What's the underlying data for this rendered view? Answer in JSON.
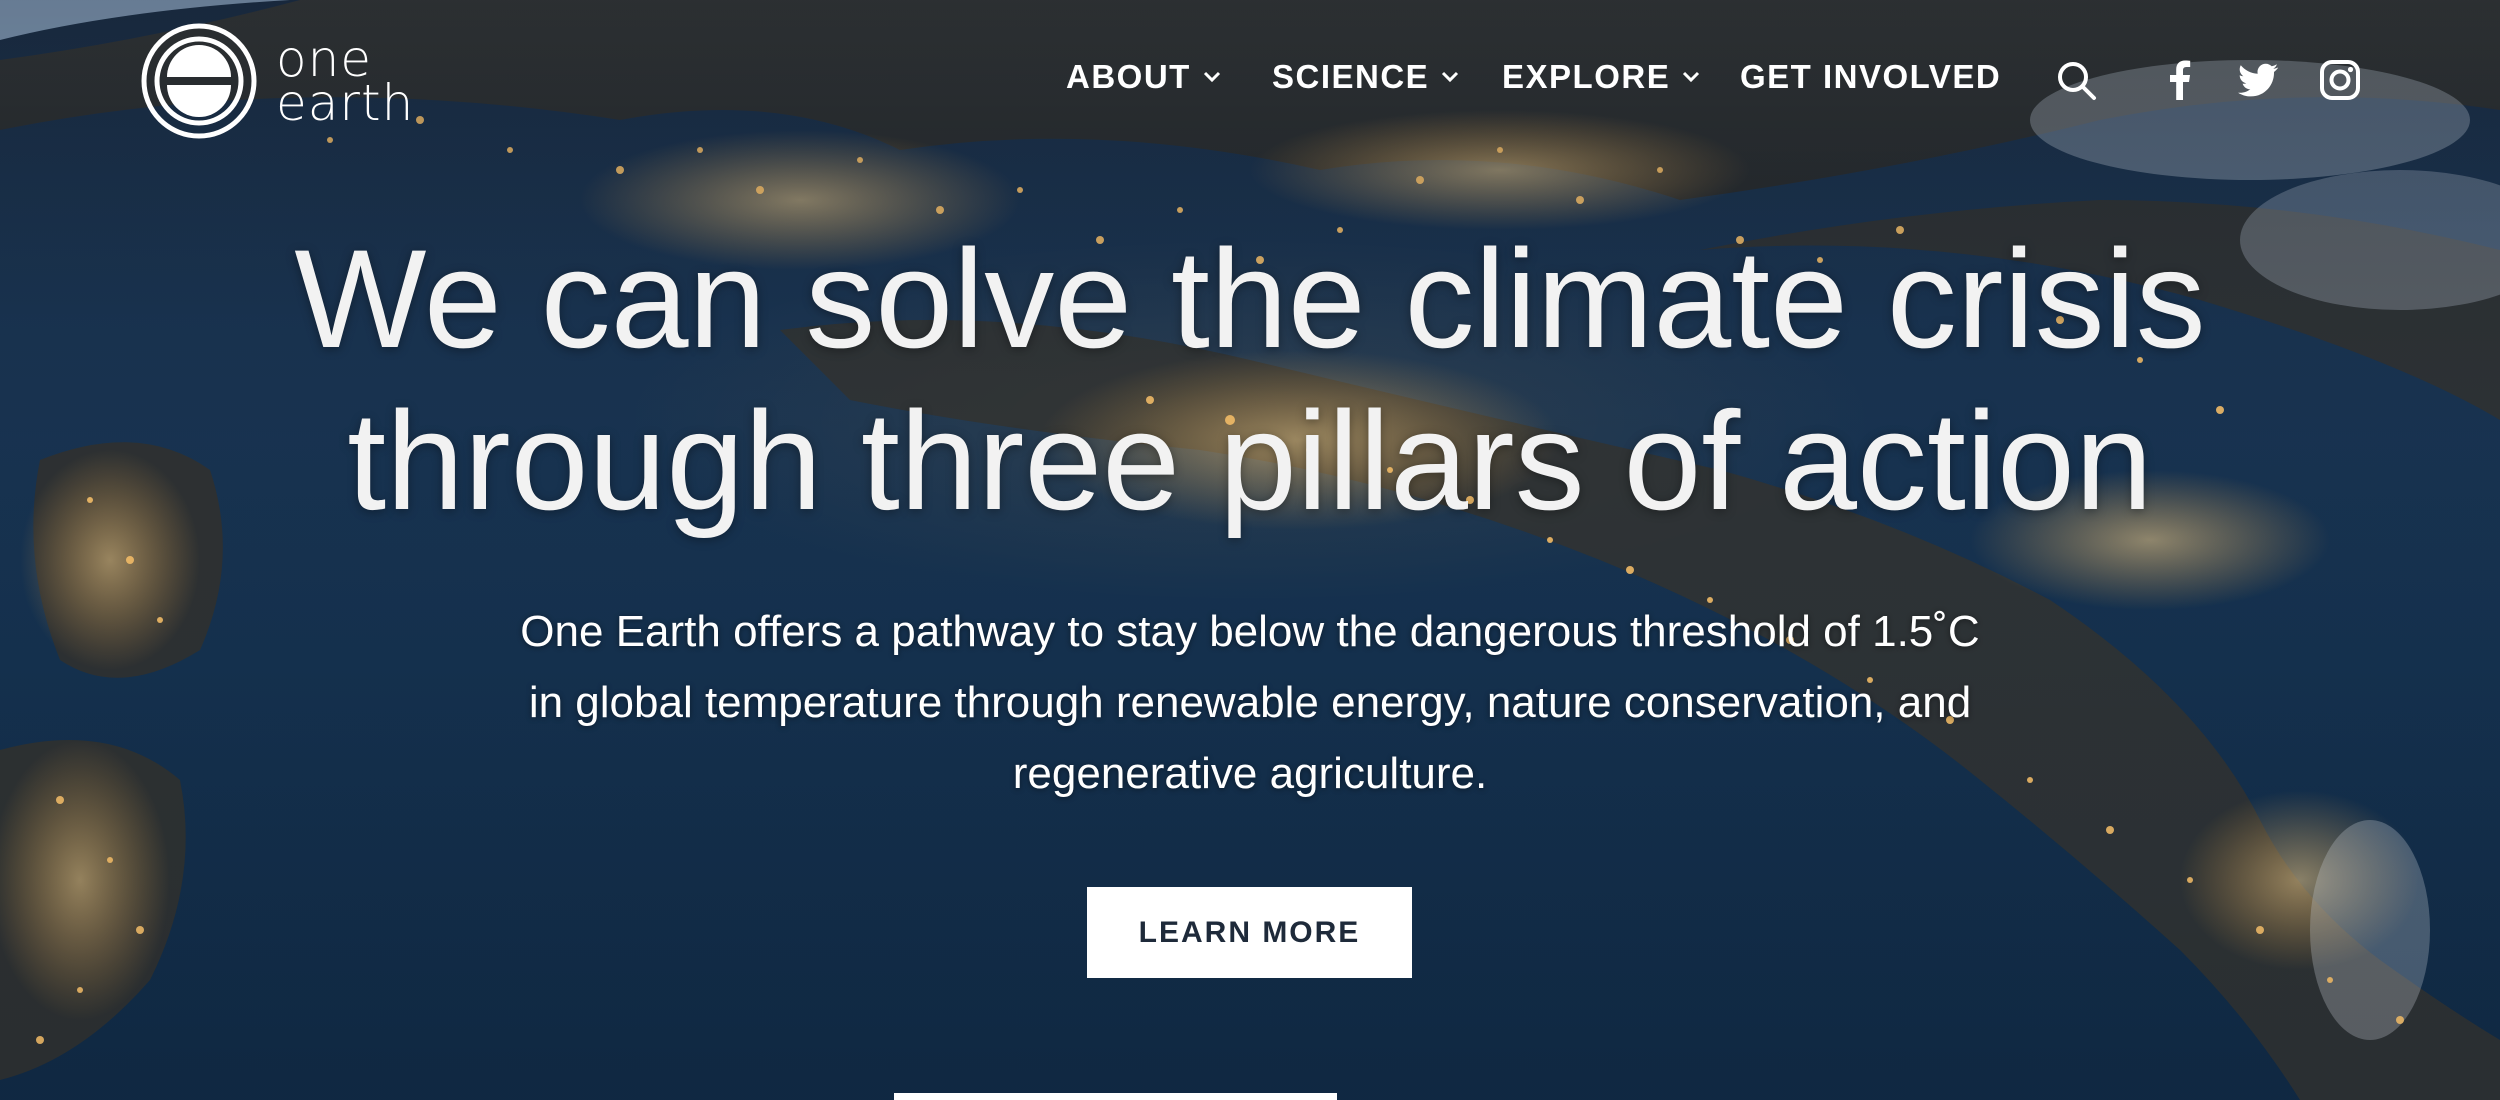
{
  "brand": {
    "logo_line1": "one",
    "logo_line2": "earth"
  },
  "nav": {
    "items": [
      {
        "label": "ABOUT",
        "has_dropdown": true
      },
      {
        "label": "SCIENCE",
        "has_dropdown": true
      },
      {
        "label": "EXPLORE",
        "has_dropdown": true
      },
      {
        "label": "GET INVOLVED",
        "has_dropdown": false
      }
    ],
    "icons": [
      "search-icon",
      "facebook-icon",
      "twitter-icon",
      "instagram-icon"
    ]
  },
  "hero": {
    "headline_line1": "We can solve the climate crisis",
    "headline_line2": "through three pillars of action",
    "sub_line1": "One Earth offers a pathway to stay below the dangerous threshold of 1.5˚C",
    "sub_line2": "in global temperature through renewable energy, nature conservation, and",
    "sub_line3": "regenerative agriculture.",
    "cta_label": "LEARN MORE"
  },
  "colors": {
    "night_sky": "#153250",
    "city_lights": "#f2b35a",
    "text": "#ffffff",
    "button_text": "#1e2a3a"
  }
}
